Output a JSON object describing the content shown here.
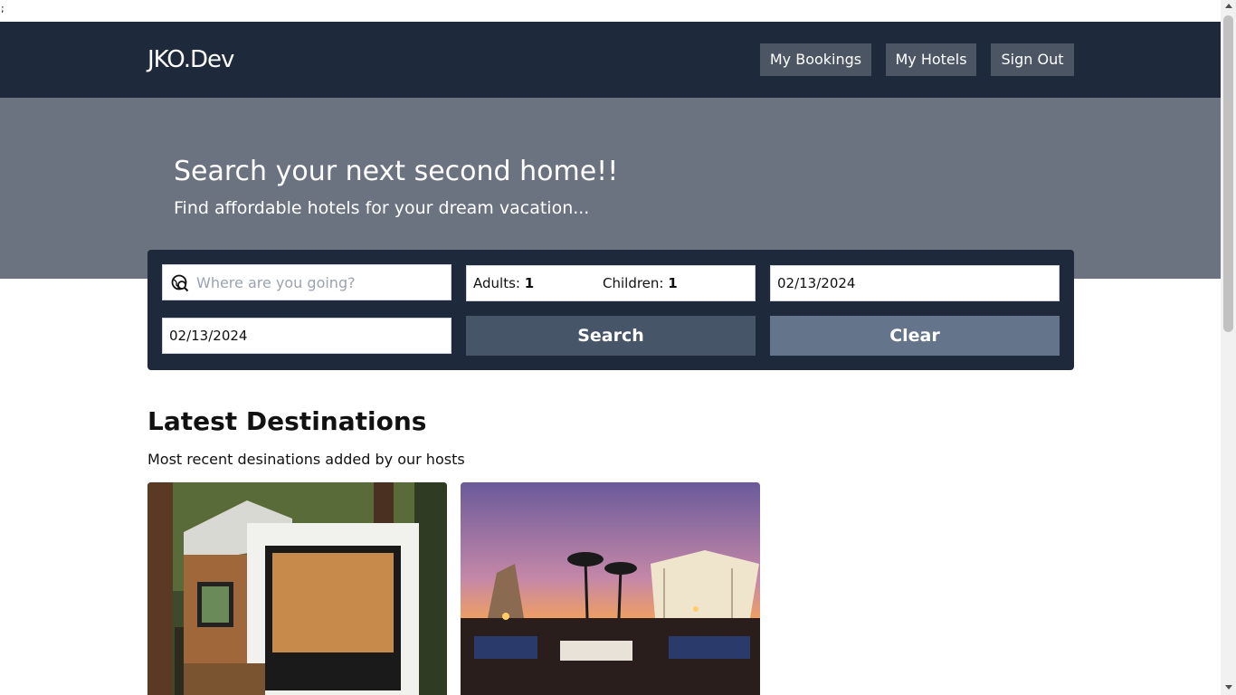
{
  "stray_text": ";",
  "header": {
    "logo": "JKO.Dev",
    "nav": {
      "bookings": "My Bookings",
      "hotels": "My Hotels",
      "signout": "Sign Out"
    }
  },
  "hero": {
    "title": "Search your next second home!!",
    "subtitle": "Find affordable hotels for your dream vacation..."
  },
  "search": {
    "destination_placeholder": "Where are you going?",
    "adults_label": "Adults:",
    "adults_value": "1",
    "children_label": "Children:",
    "children_value": "1",
    "check_in": "02/13/2024",
    "check_out": "02/13/2024",
    "search_label": "Search",
    "clear_label": "Clear"
  },
  "destinations": {
    "title": "Latest Destinations",
    "subtitle": "Most recent desinations added by our hosts"
  }
}
